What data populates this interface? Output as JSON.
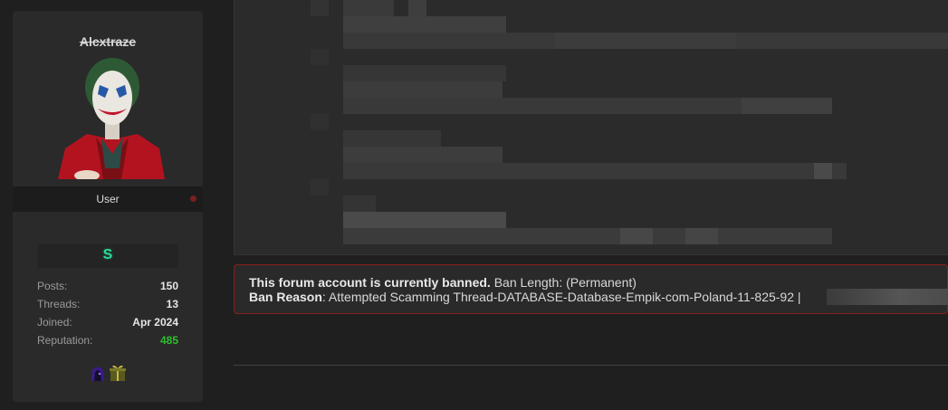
{
  "user": {
    "username": "Alcxtraze",
    "role": "User",
    "badge_glyph": "S",
    "stats": [
      {
        "label": "Posts:",
        "value": "150",
        "color": "#e6e6e6"
      },
      {
        "label": "Threads:",
        "value": "13",
        "color": "#e6e6e6"
      },
      {
        "label": "Joined:",
        "value": "Apr 2024",
        "color": "#e6e6e6"
      },
      {
        "label": "Reputation:",
        "value": "485",
        "color": "#2fbf2f"
      }
    ],
    "awards": [
      "hooded-figure-icon",
      "gift-box-icon"
    ],
    "status": "offline"
  },
  "post": {
    "content_state": "pixelated"
  },
  "ban_notice": {
    "headline": "This forum account is currently banned.",
    "length_label": "Ban Length: (Permanent)",
    "reason_label": "Ban Reason",
    "reason_text": ": Attempted Scamming Thread-DATABASE-Database-Empik-com-Poland-11-825-92 |"
  },
  "colors": {
    "page_bg": "#1f1f1f",
    "card_bg": "#2a2a2a",
    "ban_border": "#8c1d1d",
    "reputation": "#2fbf2f",
    "badge": "#33d79b"
  }
}
